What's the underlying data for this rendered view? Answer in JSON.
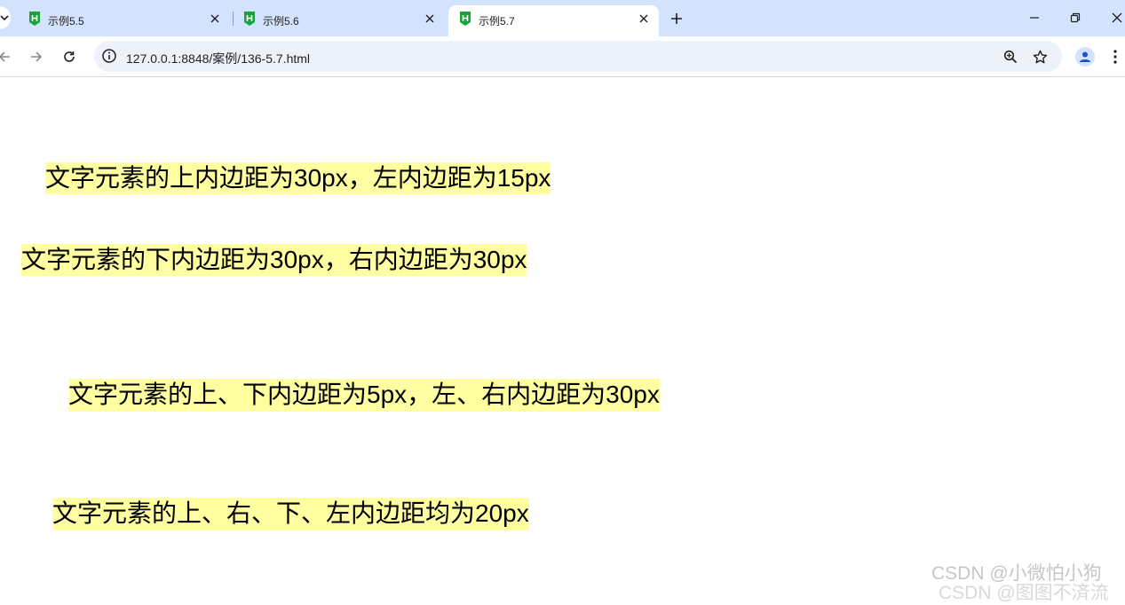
{
  "browser": {
    "tabs": [
      {
        "title": "示例5.5",
        "active": false
      },
      {
        "title": "示例5.6",
        "active": false
      },
      {
        "title": "示例5.7",
        "active": true
      }
    ],
    "url": "127.0.0.1:8848/案例/136-5.7.html",
    "colors": {
      "tabstrip": "#d3e3fd",
      "omnibox": "#edf2fa",
      "favicon": "#1aa33b"
    }
  },
  "page": {
    "lines": [
      "文字元素的上内边距为30px，左内边距为15px",
      "文字元素的下内边距为30px，右内边距为30px",
      "文字元素的上、下内边距为5px，左、右内边距为30px",
      "文字元素的上、右、下、左内边距均为20px"
    ],
    "highlight_color": "#fffea0"
  },
  "watermark": "CSDN @小微怕小狗",
  "watermark_second": "CSDN @图图不済流"
}
